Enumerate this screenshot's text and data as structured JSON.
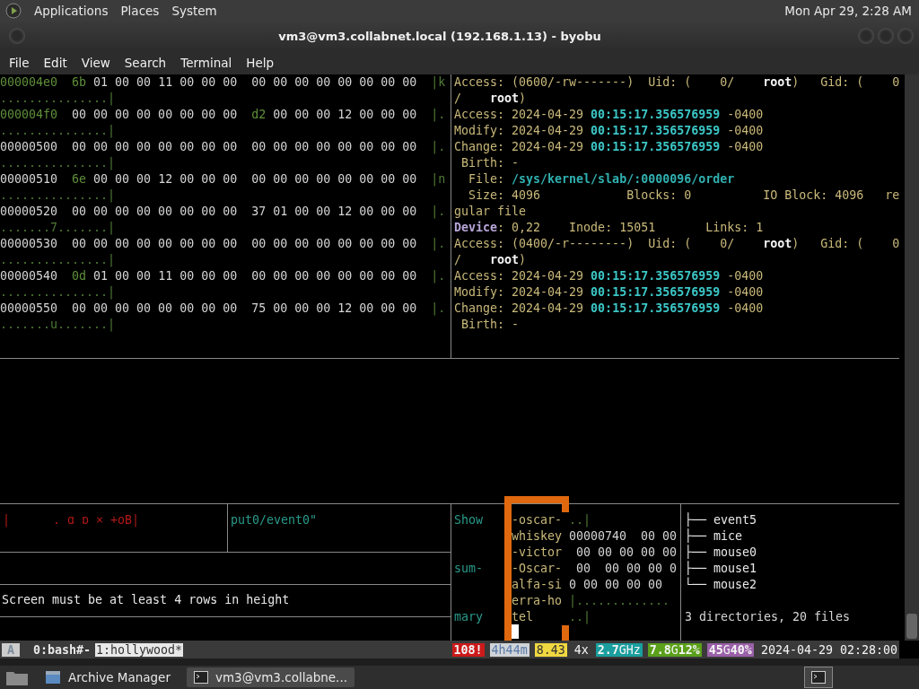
{
  "top_panel": {
    "menus": [
      "Applications",
      "Places",
      "System"
    ],
    "clock": "Mon Apr 29, 2:28 AM"
  },
  "window": {
    "title": "vm3@vm3.collabnet.local (192.168.1.13) - byobu"
  },
  "menu_bar": [
    "File",
    "Edit",
    "View",
    "Search",
    "Terminal",
    "Help"
  ],
  "hex_pane": {
    "lines": [
      [
        {
          "text": "000004e0",
          "kind": "hi"
        },
        {
          "text": "  6b",
          "kind": "hi"
        },
        {
          "text": " 01 00 00 11 00 00 00  00 00 00 00 00 00 00 00  ",
          "kind": "plain"
        },
        {
          "text": "|k",
          "kind": "ascii"
        }
      ],
      [
        {
          "text": "...............|",
          "kind": "ascii"
        }
      ],
      [
        {
          "text": "000004f0",
          "kind": "hi"
        },
        {
          "text": "  00 00 00 00 00 00 00 00  ",
          "kind": "plain"
        },
        {
          "text": "d2",
          "kind": "hi"
        },
        {
          "text": " 00 00 00 12 00 00 00  ",
          "kind": "plain"
        },
        {
          "text": "|.",
          "kind": "ascii"
        }
      ],
      [
        {
          "text": "...............|",
          "kind": "ascii"
        }
      ],
      [
        {
          "text": "00000500  00 00 00 00 00 00 00 00  00 00 00 00 00 00 00 00  ",
          "kind": "plain"
        },
        {
          "text": "|.",
          "kind": "ascii"
        }
      ],
      [
        {
          "text": "...............|",
          "kind": "ascii"
        }
      ],
      [
        {
          "text": "00000510  ",
          "kind": "plain"
        },
        {
          "text": "6e",
          "kind": "hi"
        },
        {
          "text": " 00 00 00 12 00 00 00  00 00 00 00 00 00 00 00  ",
          "kind": "plain"
        },
        {
          "text": "|n",
          "kind": "ascii"
        }
      ],
      [
        {
          "text": "...............|",
          "kind": "ascii"
        }
      ],
      [
        {
          "text": "00000520  00 00 00 00 00 00 00 00  37 01 00 00 12 00 00 00  ",
          "kind": "plain"
        },
        {
          "text": "|.",
          "kind": "ascii"
        }
      ],
      [
        {
          "text": ".......7.......|",
          "kind": "ascii"
        }
      ],
      [
        {
          "text": "00000530  00 00 00 00 00 00 00 00  00 00 00 00 00 00 00 00  ",
          "kind": "plain"
        },
        {
          "text": "|.",
          "kind": "ascii"
        }
      ],
      [
        {
          "text": "...............|",
          "kind": "ascii"
        }
      ],
      [
        {
          "text": "00000540  ",
          "kind": "plain"
        },
        {
          "text": "0d",
          "kind": "hi"
        },
        {
          "text": " 01 00 00 11 00 00 00  00 00 00 00 00 00 00 00  ",
          "kind": "plain"
        },
        {
          "text": "|.",
          "kind": "ascii"
        }
      ],
      [
        {
          "text": "...............|",
          "kind": "ascii"
        }
      ],
      [
        {
          "text": "00000550  00 00 00 00 00 00 00 00  75 00 00 00 12 00 00 00  ",
          "kind": "plain"
        },
        {
          "text": "|.",
          "kind": "ascii"
        }
      ],
      [
        {
          "text": ".......u.......|",
          "kind": "ascii"
        }
      ]
    ]
  },
  "stat_pane": {
    "lines": [
      [
        {
          "text": "Access: (0600/-rw-------)  Uid: (    0/    ",
          "kind": "label"
        },
        {
          "text": "root",
          "kind": "bold"
        },
        {
          "text": ")   Gid: (    0",
          "kind": "label"
        }
      ],
      [
        {
          "text": "/    ",
          "kind": "label"
        },
        {
          "text": "root",
          "kind": "bold"
        },
        {
          "text": ")",
          "kind": "label"
        }
      ],
      [
        {
          "text": "Access: 2024-04-29 ",
          "kind": "label"
        },
        {
          "text": "00:15:17.356576959",
          "kind": "time"
        },
        {
          "text": " -0400",
          "kind": "label"
        }
      ],
      [
        {
          "text": "Modify: 2024-04-29 ",
          "kind": "label"
        },
        {
          "text": "00:15:17.356576959",
          "kind": "time"
        },
        {
          "text": " -0400",
          "kind": "label"
        }
      ],
      [
        {
          "text": "Change: 2024-04-29 ",
          "kind": "label"
        },
        {
          "text": "00:15:17.356576959",
          "kind": "time"
        },
        {
          "text": " -0400",
          "kind": "label"
        }
      ],
      [
        {
          "text": " Birth: -",
          "kind": "label"
        }
      ],
      [
        {
          "text": "  File: ",
          "kind": "label"
        },
        {
          "text": "/sys/kernel/slab/:0000096/order",
          "kind": "path"
        }
      ],
      [
        {
          "text": "  Size: 4096            Blocks: 0          IO Block: 4096   re",
          "kind": "label"
        }
      ],
      [
        {
          "text": "gular file",
          "kind": "label"
        }
      ],
      [
        {
          "text": "Device",
          "kind": "device"
        },
        {
          "text": ": 0,22    Inode: 15051       Links: 1",
          "kind": "label"
        }
      ],
      [
        {
          "text": "Access: (0400/-r--------)  Uid: (    0/    ",
          "kind": "label"
        },
        {
          "text": "root",
          "kind": "bold"
        },
        {
          "text": ")   Gid: (    0",
          "kind": "label"
        }
      ],
      [
        {
          "text": "/    ",
          "kind": "label"
        },
        {
          "text": "root",
          "kind": "bold"
        },
        {
          "text": ")",
          "kind": "label"
        }
      ],
      [
        {
          "text": "Access: 2024-04-29 ",
          "kind": "label"
        },
        {
          "text": "00:15:17.356576959",
          "kind": "time"
        },
        {
          "text": " -0400",
          "kind": "label"
        }
      ],
      [
        {
          "text": "Modify: 2024-04-29 ",
          "kind": "label"
        },
        {
          "text": "00:15:17.356576959",
          "kind": "time"
        },
        {
          "text": " -0400",
          "kind": "label"
        }
      ],
      [
        {
          "text": "Change: 2024-04-29 ",
          "kind": "label"
        },
        {
          "text": "00:15:17.356576959",
          "kind": "time"
        },
        {
          "text": " -0400",
          "kind": "label"
        }
      ],
      [
        {
          "text": " Birth: -",
          "kind": "label"
        }
      ]
    ]
  },
  "bottom_left": {
    "glyph_line": "|      . ɑ ɒ × +oB|",
    "event_line": "put0/event0\"",
    "message": "Screen must be at least 4 rows in height"
  },
  "overlay_pane": {
    "rows": [
      {
        "label": "Show",
        "name": "-oscar-",
        "rest": {
          "text": "..|",
          "kind": "ascii"
        }
      },
      {
        "name": "whiskey",
        "rest": {
          "text": "00000740  00 00",
          "kind": "plain"
        }
      },
      {
        "name": "-victor",
        "rest": {
          "text": " 00 00 00 00 00",
          "kind": "plain"
        }
      },
      {
        "label": "sum-",
        "name": "-Oscar-",
        "rest": {
          "text": " 00  00 00 00 0",
          "kind": "plain"
        }
      },
      {
        "name": "alfa-si",
        "rest": {
          "text": "0 00 00 00 00",
          "kind": "plain"
        }
      },
      {
        "name": "erra-ho",
        "rest": {
          "text": "|.............",
          "kind": "ascii"
        }
      },
      {
        "label": "mary",
        "name": "tel",
        "rest": {
          "text": "..|",
          "kind": "ascii"
        }
      }
    ]
  },
  "tree_pane": {
    "items": [
      {
        "branch": "├──",
        "name": "event5"
      },
      {
        "branch": "├──",
        "name": "mice"
      },
      {
        "branch": "├──",
        "name": "mouse0"
      },
      {
        "branch": "├──",
        "name": "mouse1"
      },
      {
        "branch": "└──",
        "name": "mouse2"
      }
    ],
    "summary": "3 directories, 20 files"
  },
  "status_bar": {
    "session": "A",
    "windows": [
      {
        "label": "0:bash#-",
        "selected": false
      },
      {
        "label": "1:hollywood*",
        "selected": true
      }
    ],
    "indicators": [
      {
        "text": "**108!**",
        "color": "#cc1a1a"
      },
      {
        "text": "4h44m",
        "color": "#d0d4d8"
      },
      {
        "text": "8.43",
        "color": "#f0d840"
      },
      {
        "text": "4x",
        "color": "#3a3a3a"
      },
      {
        "text": "**2.7**GHz",
        "color": "#1a9e9e"
      },
      {
        "text": "**7.8**G**12%**",
        "color": "#5aa01a"
      },
      {
        "text": "**45**G**40%**",
        "color": "#9a60a8"
      },
      {
        "text": "2024-04-29 02:28:00",
        "color": "#3a3a3a"
      }
    ]
  },
  "taskbar": {
    "items": [
      {
        "label": "Archive Manager",
        "kind": "archive",
        "selected": false
      },
      {
        "label": "vm3@vm3.collabne...",
        "kind": "terminal",
        "selected": true
      }
    ]
  }
}
